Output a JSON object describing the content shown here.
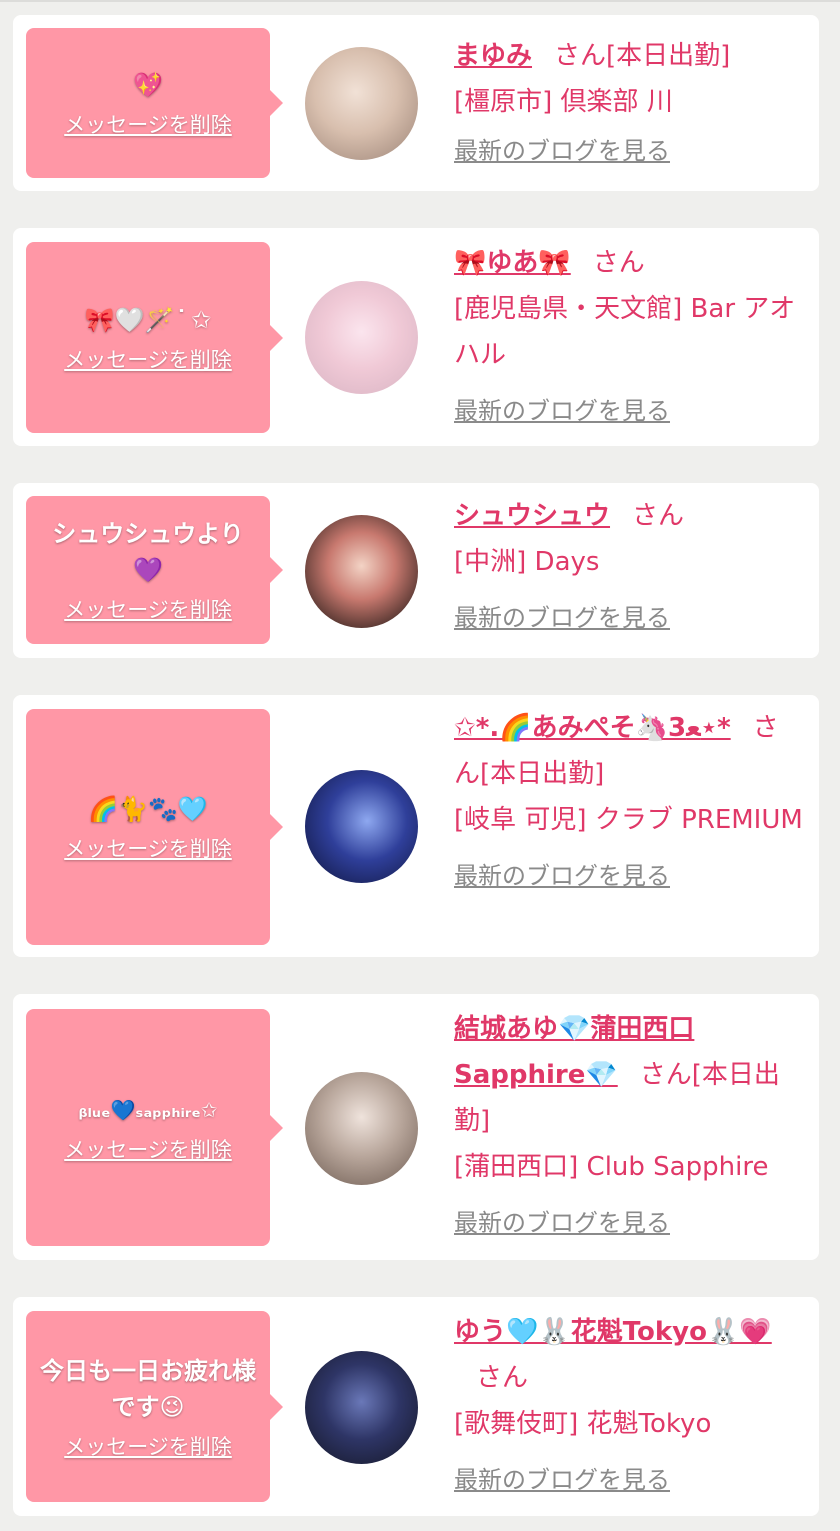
{
  "colors": {
    "accent": "#e03868",
    "bubble": "#ff97a6",
    "background": "#efefed",
    "link_gray": "#8a8a8a"
  },
  "entries": [
    {
      "message": "💖",
      "delete_label": "メッセージを削除",
      "name": "まゆみ",
      "honorific": "さん",
      "status": "[本日出勤]",
      "location": "[橿原市] 倶楽部 川",
      "blog_label": "最新のブログを見る"
    },
    {
      "message": "🎀🤍🪄 ͘ ✩",
      "delete_label": "メッセージを削除",
      "name": "🎀ゆあ🎀",
      "honorific": "さん",
      "status": "",
      "location": "[鹿児島県・天文館] Bar アオハル",
      "blog_label": "最新のブログを見る"
    },
    {
      "message": "シュウシュウより💜",
      "delete_label": "メッセージを削除",
      "name": "シュウシュウ",
      "honorific": "さん",
      "status": "",
      "location": "[中洲] Days",
      "blog_label": "最新のブログを見る"
    },
    {
      "message": "🌈🐈🐾🩵",
      "delete_label": "メッセージを削除",
      "name": "✩*.🌈あみぺそ🦄ﻌ3⋆*",
      "honorific": "さん",
      "status": "[本日出勤]",
      "location": "[岐阜 可児] クラブ PREMIUM",
      "blog_label": "最新のブログを見る"
    },
    {
      "message": "ᵦₗᵤₑ💙ₛₐₚₚₕᵢᵣₑ✩",
      "delete_label": "メッセージを削除",
      "name": "結城あゆ💎蒲田西口Sapphire💎",
      "honorific": "さん",
      "status": "[本日出勤]",
      "location": "[蒲田西口] Club Sapphire",
      "blog_label": "最新のブログを見る"
    },
    {
      "message": "今日も一日お疲れ様です😉",
      "delete_label": "メッセージを削除",
      "name": "ゆう🩵🐰花魁Tokyo🐰💗",
      "honorific": "さん",
      "status": "",
      "location": "[歌舞伎町] 花魁Tokyo",
      "blog_label": "最新のブログを見る"
    }
  ]
}
